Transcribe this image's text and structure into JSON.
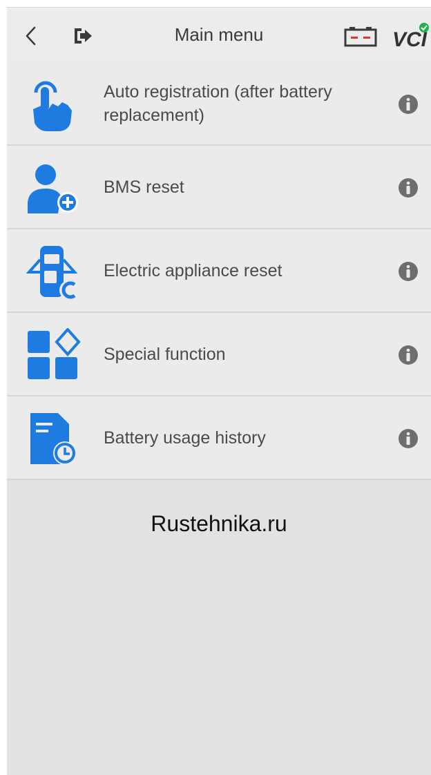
{
  "header": {
    "title": "Main menu",
    "vci_label": "VCI",
    "icons": [
      "back-chevron-icon",
      "logout-icon",
      "battery-icon",
      "vci-connected-icon"
    ]
  },
  "colors": {
    "accent": "#1e7be0",
    "background": "#e2e2e2",
    "row": "#ebebeb",
    "info": "#6e6e6e",
    "status_ok": "#21b04b",
    "battery_red": "#e3342f"
  },
  "menu": {
    "items": [
      {
        "label": "Auto registration (after battery replacement)",
        "icon": "hand-tap-icon"
      },
      {
        "label": "BMS reset",
        "icon": "person-add-icon"
      },
      {
        "label": "Electric appliance reset",
        "icon": "car-door-icon"
      },
      {
        "label": "Special function",
        "icon": "grid-diamond-icon"
      },
      {
        "label": "Battery usage history",
        "icon": "document-clock-icon"
      }
    ]
  },
  "watermark": "Rustehnika.ru"
}
